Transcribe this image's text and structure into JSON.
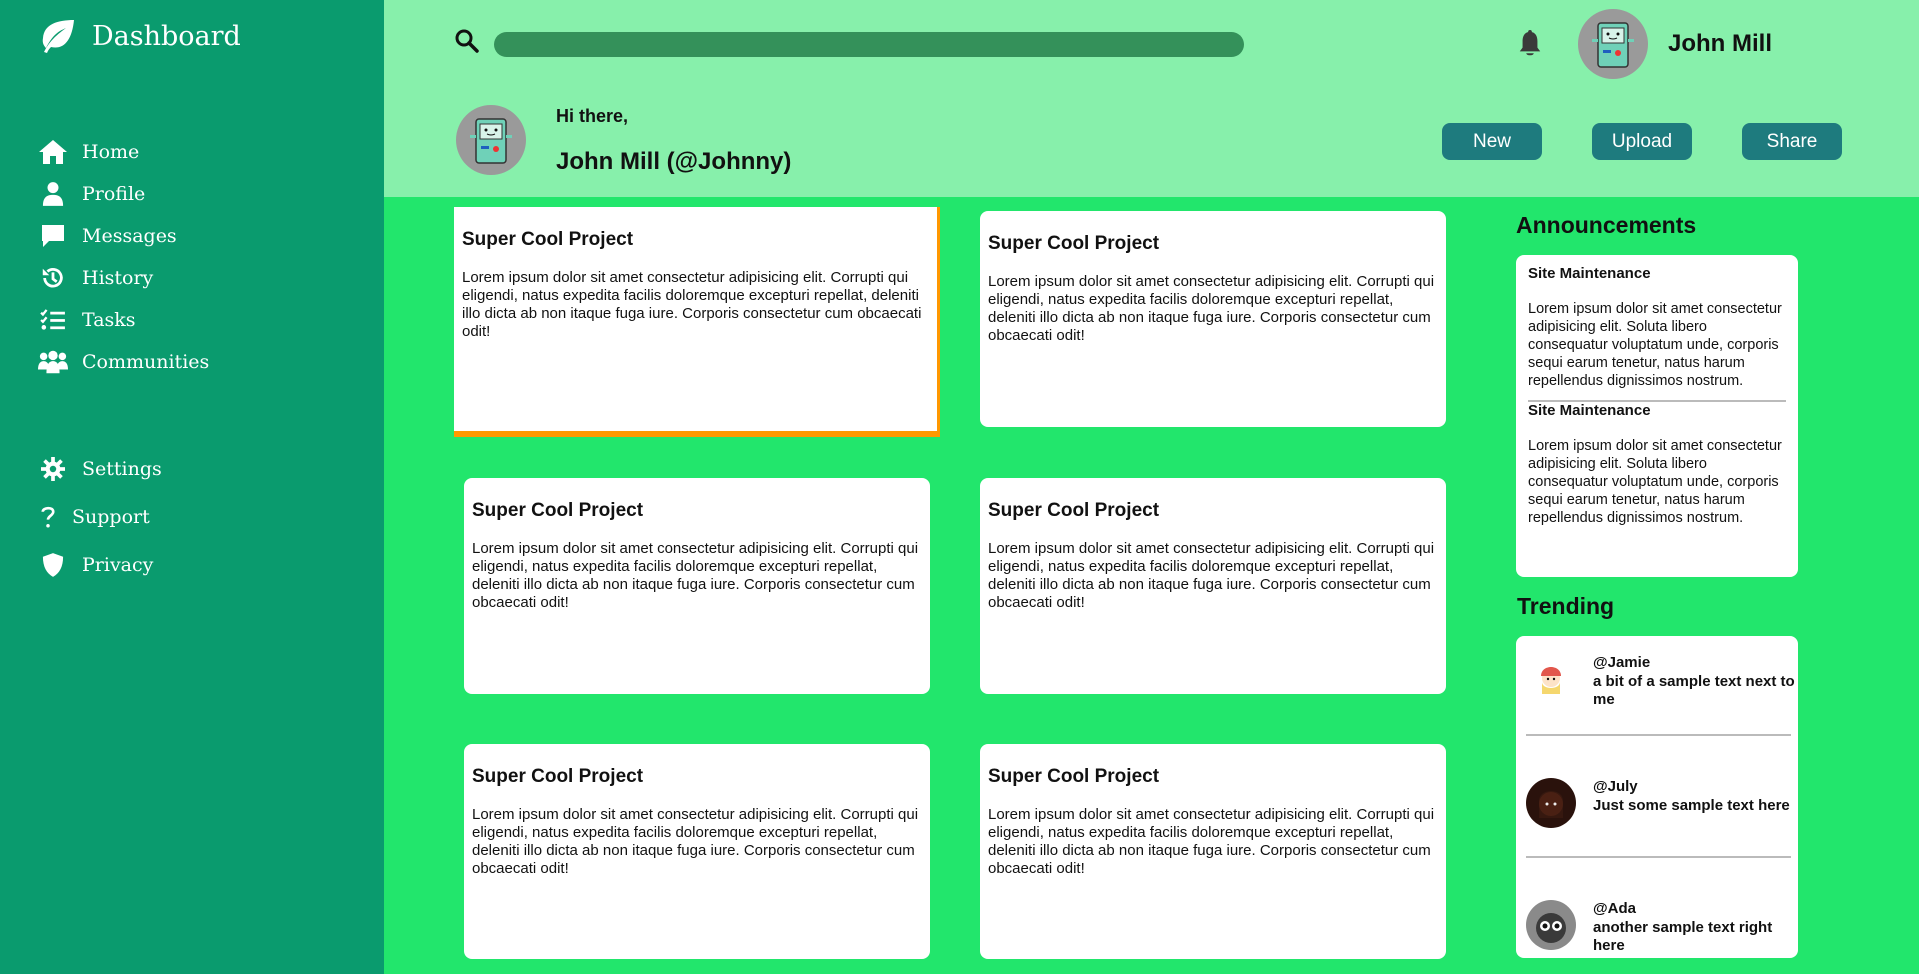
{
  "sidebar": {
    "brand": "Dashboard",
    "items": [
      {
        "label": "Home",
        "icon": "home-icon"
      },
      {
        "label": "Profile",
        "icon": "user-icon"
      },
      {
        "label": "Messages",
        "icon": "message-icon"
      },
      {
        "label": "History",
        "icon": "history-icon"
      },
      {
        "label": "Tasks",
        "icon": "tasks-icon"
      },
      {
        "label": "Communities",
        "icon": "users-icon"
      }
    ],
    "secondary": [
      {
        "label": "Settings",
        "icon": "gear-icon"
      },
      {
        "label": "Support",
        "icon": "question-icon"
      },
      {
        "label": "Privacy",
        "icon": "shield-icon"
      }
    ]
  },
  "header": {
    "search_value": "",
    "username": "John Mill",
    "greeting": "Hi there,",
    "full_name": "John Mill (@Johnny)",
    "buttons": {
      "new": "New",
      "upload": "Upload",
      "share": "Share"
    }
  },
  "projects": [
    {
      "title": "Super Cool Project",
      "body": "Lorem ipsum dolor sit amet consectetur adipisicing elit. Corrupti qui eligendi, natus expedita facilis doloremque excepturi repellat, deleniti illo dicta ab non itaque fuga iure. Corporis consectetur cum obcaecati odit!"
    },
    {
      "title": "Super Cool Project",
      "body": "Lorem ipsum dolor sit amet consectetur adipisicing elit. Corrupti qui eligendi, natus expedita facilis doloremque excepturi repellat, deleniti illo dicta ab non itaque fuga iure. Corporis consectetur cum obcaecati odit!"
    },
    {
      "title": "Super Cool Project",
      "body": "Lorem ipsum dolor sit amet consectetur adipisicing elit. Corrupti qui eligendi, natus expedita facilis doloremque excepturi repellat, deleniti illo dicta ab non itaque fuga iure. Corporis consectetur cum obcaecati odit!"
    },
    {
      "title": "Super Cool Project",
      "body": "Lorem ipsum dolor sit amet consectetur adipisicing elit. Corrupti qui eligendi, natus expedita facilis doloremque excepturi repellat, deleniti illo dicta ab non itaque fuga iure. Corporis consectetur cum obcaecati odit!"
    },
    {
      "title": "Super Cool Project",
      "body": "Lorem ipsum dolor sit amet consectetur adipisicing elit. Corrupti qui eligendi, natus expedita facilis doloremque excepturi repellat, deleniti illo dicta ab non itaque fuga iure. Corporis consectetur cum obcaecati odit!"
    },
    {
      "title": "Super Cool Project",
      "body": "Lorem ipsum dolor sit amet consectetur adipisicing elit. Corrupti qui eligendi, natus expedita facilis doloremque excepturi repellat, deleniti illo dicta ab non itaque fuga iure. Corporis consectetur cum obcaecati odit!"
    }
  ],
  "announcements": {
    "title": "Announcements",
    "items": [
      {
        "title": "Site Maintenance",
        "body": "Lorem ipsum dolor sit amet consectetur adipisicing elit. Soluta libero consequatur voluptatum unde, corporis sequi earum tenetur, natus harum repellendus dignissimos nostrum."
      },
      {
        "title": "Site Maintenance",
        "body": "Lorem ipsum dolor sit amet consectetur adipisicing elit. Soluta libero consequatur voluptatum unde, corporis sequi earum tenetur, natus harum repellendus dignissimos nostrum."
      }
    ]
  },
  "trending": {
    "title": "Trending",
    "items": [
      {
        "handle": "@Jamie",
        "text": "a bit of a sample text next to me"
      },
      {
        "handle": "@July",
        "text": "Just some sample text here"
      },
      {
        "handle": "@Ada",
        "text": "another sample text right here"
      }
    ]
  },
  "colors": {
    "sidebar": "#0a9b6e",
    "header": "#87f0ab",
    "background": "#22e66c",
    "button": "#1e7b7e",
    "active_accent": "#ff9800"
  }
}
